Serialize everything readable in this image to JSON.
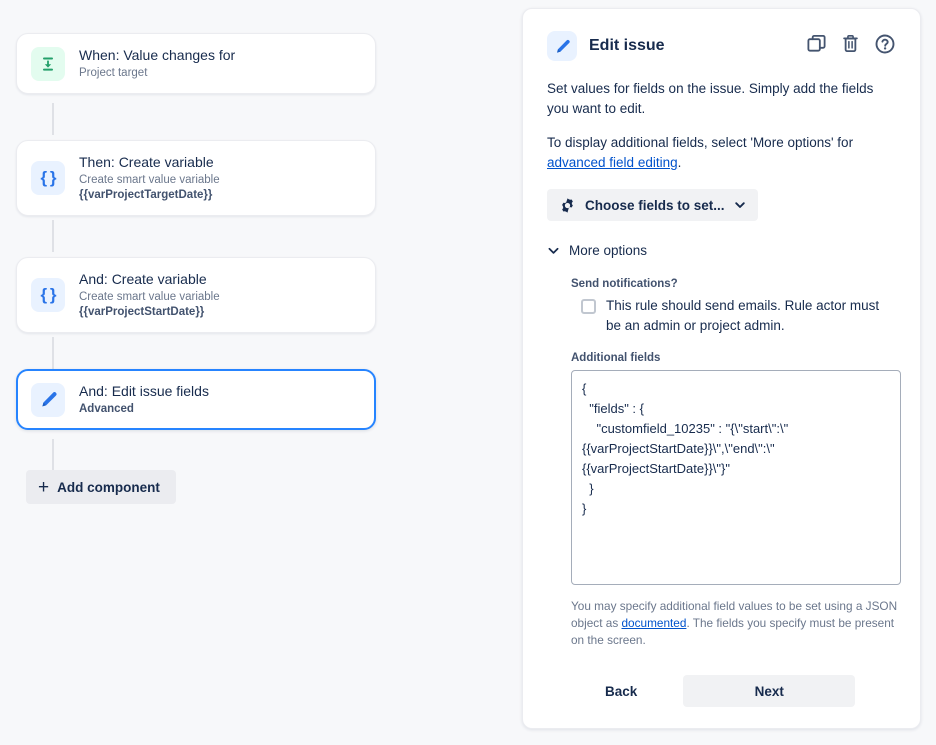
{
  "rule_canvas": {
    "nodes": [
      {
        "title": "When: Value changes for",
        "subtitle": "Project target",
        "icon": "value-changes-icon",
        "icon_tile": "#e3fcef",
        "selected": false
      },
      {
        "title": "Then: Create variable",
        "subtitle": "Create smart value variable",
        "detail": "{{varProjectTargetDate}}",
        "icon": "curly-braces-icon",
        "icon_tile": "#e9f2ff",
        "selected": false
      },
      {
        "title": "And: Create variable",
        "subtitle": "Create smart value variable",
        "detail": "{{varProjectStartDate}}",
        "icon": "curly-braces-icon",
        "icon_tile": "#e9f2ff",
        "selected": false
      },
      {
        "title": "And: Edit issue fields",
        "subtitle": "Advanced",
        "icon": "pencil-icon",
        "icon_tile": "#e9f2ff",
        "selected": true
      }
    ],
    "add_component_label": "Add component",
    "add_component_icon": "plus-icon"
  },
  "panel": {
    "icon": "pencil-icon",
    "title": "Edit issue",
    "actions": [
      {
        "name": "duplicate-icon",
        "tooltip": "Duplicate"
      },
      {
        "name": "trash-icon",
        "tooltip": "Delete"
      },
      {
        "name": "help-icon",
        "tooltip": "Help"
      }
    ],
    "description_1": "Set values for fields on the issue. Simply add the fields you want to edit.",
    "description_2_prefix": "To display additional fields, select 'More options' for ",
    "description_2_link": "advanced field editing",
    "description_2_suffix": ".",
    "choose_fields_button": "Choose fields to set...",
    "choose_fields_icon": "gear-icon",
    "choose_fields_chevron": "chevron-down-icon",
    "more_options_label": "More options",
    "more_options_icon": "chevron-down-icon",
    "send_notifications_label": "Send notifications?",
    "send_notifications_checkbox_label": "This rule should send emails. Rule actor must be an admin or project admin.",
    "send_notifications_checked": false,
    "additional_fields_label": "Additional fields",
    "additional_fields_value": "{\n  \"fields\" : {\n    \"customfield_10235\" : \"{\\\"start\\\":\\\"{{varProjectStartDate}}\\\",\\\"end\\\":\\\"{{varProjectStartDate}}\\\"}\"\n  }\n}",
    "help_prefix": "You may specify additional field values to be set using a JSON object as ",
    "help_link": "documented",
    "help_suffix": ". The fields you specify must be present on the screen.",
    "back_button": "Back",
    "next_button": "Next"
  },
  "colors": {
    "accent": "#0052cc",
    "selected_border": "#2684ff",
    "trigger_tile": "#e3fcef",
    "action_tile": "#e9f2ff",
    "canvas_bg": "#f7f8fa"
  }
}
